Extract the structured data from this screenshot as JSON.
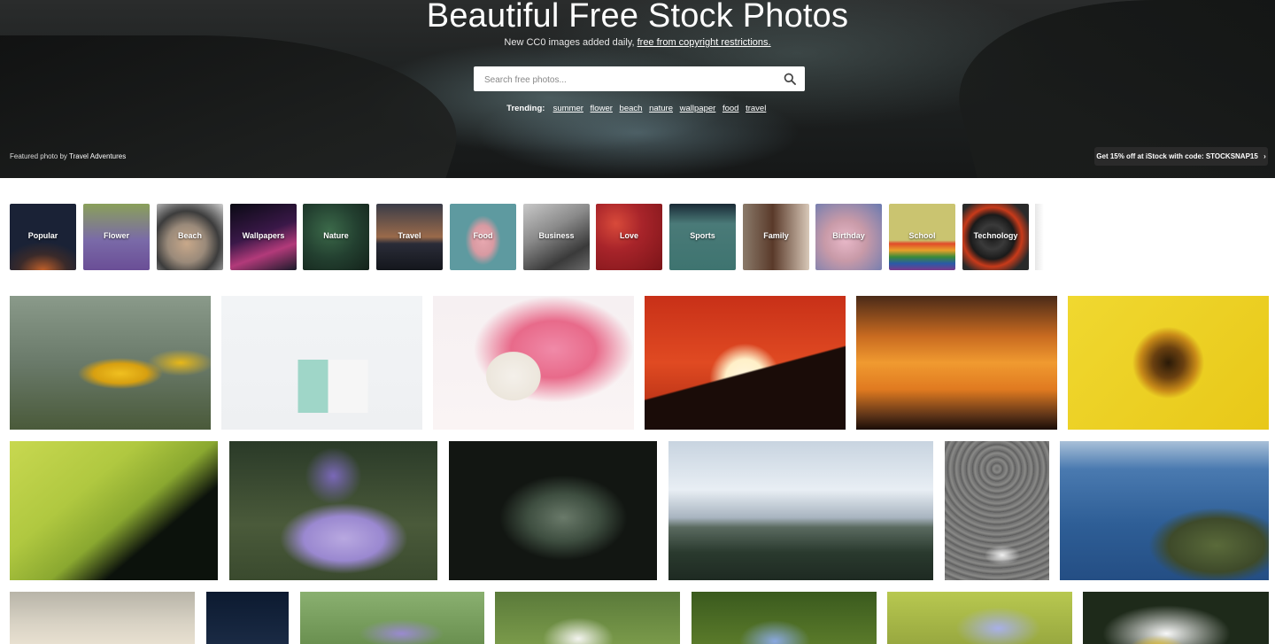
{
  "hero": {
    "title": "Beautiful Free Stock Photos",
    "subtitle_prefix": "New CC0 images added daily, ",
    "subtitle_link": "free from copyright restrictions.",
    "search_placeholder": "Search free photos...",
    "trending_label": "Trending:",
    "trending_tags": [
      "summer",
      "flower",
      "beach",
      "nature",
      "wallpaper",
      "food",
      "travel"
    ],
    "featured_prefix": "Featured photo by ",
    "featured_author": "Travel Adventures",
    "promo_text": "Get 15% off at iStock with code: STOCKSNAP15"
  },
  "categories": [
    "Popular",
    "Flower",
    "Beach",
    "Wallpapers",
    "Nature",
    "Travel",
    "Food",
    "Business",
    "Love",
    "Sports",
    "Family",
    "Birthday",
    "School",
    "Technology"
  ],
  "icons": {
    "search": "search-icon",
    "promo_arrow": "chevron-right-icon"
  }
}
